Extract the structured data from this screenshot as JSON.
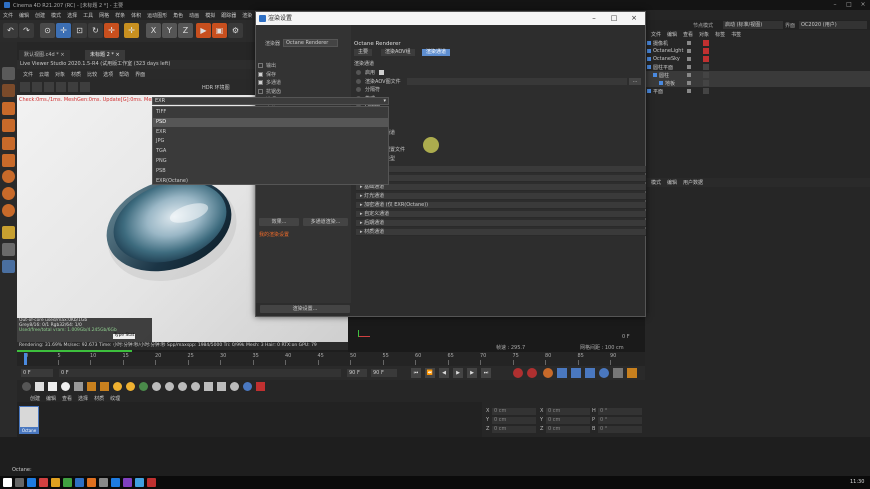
{
  "window": {
    "title": "Cinema 4D R21.207 (RC) - [未标题 2 *] - 主要"
  },
  "menubar": [
    "文件",
    "编辑",
    "创建",
    "模式",
    "选择",
    "工具",
    "网格",
    "样条",
    "体积",
    "运动图形",
    "角色",
    "动画",
    "模拟",
    "跟踪器",
    "渲染",
    "扩展",
    "窗口",
    "帮助"
  ],
  "toolbar": {
    "axis_x": "X",
    "axis_y": "Y",
    "axis_z": "Z"
  },
  "tabs": [
    "默认视图.c4d *",
    "未标题 2 *"
  ],
  "live_viewer": {
    "title": "Live Viewer Studio 2020.1.5-R4 (试用版工作室 (323 days left)",
    "menu": [
      "文件",
      "云端",
      "对象",
      "材质",
      "比较",
      "选项",
      "帮助",
      "界面"
    ],
    "hdr_label": "HDR 环境图",
    "info": "Check:0ms./1ms. MeshGen:0ms. Update[G]:0ms. Mesh:1 Nodes:16 Movable:2 txCached:0"
  },
  "stats": {
    "line1": "Out-of-core used/max:0Kb/1Gb",
    "line2": "Grey8/16: 0/1        Rgb32/64: 1/0",
    "line3": "Used/free/total vram: 1.009Gb/4.245Gb/6Gb",
    "tags": "Type  Stat"
  },
  "rendering_line": "Rendering: 31.69%  Ms/sec: 92.673  Time: 小时:分钟:秒/小时:分钟:秒  Spp/maxspp: 1984/5000  Tri: 0/99k  Mesh: 3  Hair: 0  RTX:on  GPU: 79",
  "timeline": {
    "ticks": [
      "0",
      "5",
      "10",
      "15",
      "20",
      "25",
      "30",
      "35",
      "40",
      "45",
      "50",
      "55",
      "60",
      "65",
      "70",
      "75",
      "80",
      "85",
      "90"
    ],
    "start": "0 F",
    "mid": "0 F",
    "end": "90 F",
    "end2": "90 F",
    "frame_rate": "帧速 : 295.7",
    "zoom": "网格间距 : 100 cm",
    "frame_right": "0 F"
  },
  "material_panel": {
    "menu": [
      "创建",
      "编辑",
      "查看",
      "选择",
      "材质",
      "纹理"
    ],
    "material_name": "Octane"
  },
  "coords": {
    "rows": [
      {
        "axis": "X",
        "pos": "0 cm",
        "axis2": "X",
        "size": "0 cm",
        "axis3": "H",
        "rot": "0 °"
      },
      {
        "axis": "Y",
        "pos": "0 cm",
        "axis2": "Y",
        "size": "0 cm",
        "axis3": "P",
        "rot": "0 °"
      },
      {
        "axis": "Z",
        "pos": "0 cm",
        "axis2": "Z",
        "size": "0 cm",
        "axis3": "B",
        "rot": "0 °"
      }
    ],
    "mode1": "世界坐标",
    "mode2": "缩放比例",
    "apply": "应用"
  },
  "right_panel": {
    "header_menu": [
      "文件",
      "编辑",
      "查看",
      "对象",
      "标签",
      "书签"
    ],
    "layout_label": "节点模式",
    "layout_value": "启动 (标准/视图)",
    "interface_label": "界面",
    "interface_value": "OC2020 (用户)",
    "objects": [
      "摄像机",
      "OctaneLight",
      "OctaneSky",
      "圆柱平面",
      "圆柱",
      "地板",
      "平面"
    ],
    "attr_menu": [
      "模式",
      "编辑",
      "用户数据"
    ]
  },
  "status": {
    "text": "Octane:"
  },
  "taskbar": {
    "time": "11:30"
  },
  "dialog": {
    "title": "渲染设置",
    "renderer_label": "渲染器",
    "renderer_value": "Octane Renderer",
    "tree": [
      {
        "label": "输出",
        "checked": false
      },
      {
        "label": "保存",
        "checked": true
      },
      {
        "label": "多通道",
        "checked": true
      },
      {
        "label": "抗锯齿",
        "checked": false
      },
      {
        "label": "选项",
        "checked": false
      },
      {
        "label": "立体",
        "checked": false
      },
      {
        "label": "Team Render",
        "checked": false
      },
      {
        "label": "材质覆写",
        "checked": false
      },
      {
        "label": "Octane Renderer",
        "checked": false
      }
    ],
    "effect_btn": "效果...",
    "multi_btn": "多通道渲染...",
    "my_settings": "我的渲染设置",
    "footer_btn": "渲染设置...",
    "right": {
      "heading": "Octane Renderer",
      "tabs": [
        "主要",
        "渲染AOV组",
        "渲染通道"
      ],
      "section": "渲染通道",
      "props": [
        {
          "label": "启用"
        },
        {
          "label": "渲染AOV图文件"
        },
        {
          "label": "分隔符"
        },
        {
          "label": "格式"
        },
        {
          "label": "Depth"
        },
        {
          "label": "压缩"
        },
        {
          "label": "显示通道"
        },
        {
          "label": "保存优化通道"
        },
        {
          "label": "多层文件"
        },
        {
          "label": "图像颜色配置文件"
        },
        {
          "label": "色调映射类型"
        }
      ],
      "format_value": "EXR",
      "dropdown_options": [
        "TIFF",
        "PSD",
        "EXR",
        "JPG",
        "TGA",
        "PNG",
        "PSB",
        "EXR(Octane)"
      ],
      "dropdown_selected": "PSD",
      "sections": [
        "信息通道",
        "光照通道",
        "基础通道",
        "灯光通道",
        "加密通道 (仅 EXR(Octane))",
        "自定义通道",
        "后期通道",
        "材质通道"
      ]
    }
  }
}
